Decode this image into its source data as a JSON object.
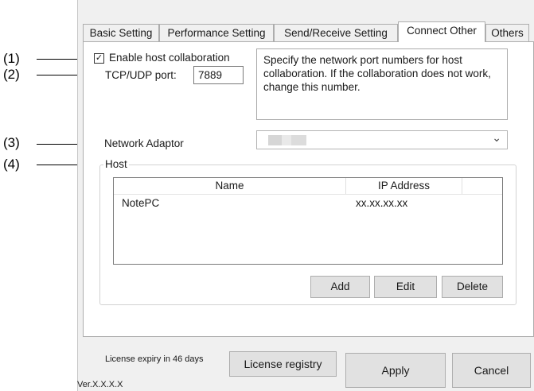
{
  "callouts": [
    "(1)",
    "(2)",
    "(3)",
    "(4)"
  ],
  "tabs": [
    {
      "label": "Basic Setting",
      "active": false
    },
    {
      "label": "Performance Setting",
      "active": false
    },
    {
      "label": "Send/Receive Setting",
      "active": false
    },
    {
      "label": "Connect Other",
      "active": true
    },
    {
      "label": "Others",
      "active": false
    }
  ],
  "connect": {
    "enable_label": "Enable host collaboration",
    "enable_checked": true,
    "check_glyph": "✓",
    "port_label": "TCP/UDP port:",
    "port_value": "7889",
    "description": "Specify the network port numbers for host collaboration. If the collaboration does not work, change this number.",
    "adaptor_label": "Network Adaptor",
    "adaptor_value": "",
    "dropdown_icon": "chevron-down-icon",
    "chevron_glyph": "⌄",
    "host_label": "Host",
    "columns": [
      "Name",
      "IP Address"
    ],
    "rows": [
      {
        "name": "NotePC",
        "ip": "xx.xx.xx.xx"
      }
    ],
    "buttons": {
      "add": "Add",
      "edit": "Edit",
      "delete": "Delete"
    }
  },
  "footer": {
    "license_text": "License expiry in 46 days",
    "license_button": "License registry",
    "apply": "Apply",
    "cancel": "Cancel",
    "version": "Ver.X.X.X.X"
  }
}
